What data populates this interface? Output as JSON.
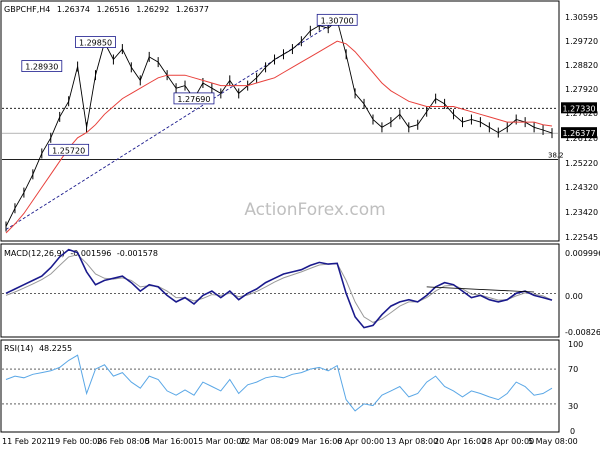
{
  "header": {
    "symbol": "GBPCHF,H4",
    "open": "1.26374",
    "high": "1.26516",
    "low": "1.26292",
    "close": "1.26377"
  },
  "watermark": "ActionForex.com",
  "colors": {
    "candles": "#000000",
    "ma": "#e8413c",
    "trend": "#1a1a8c",
    "macd": "#1a1a8c",
    "signal": "#9a9a9a",
    "rsi": "#5aa7e6",
    "label_border": "#1a1a8c",
    "grid": "#ffffff"
  },
  "x_axis": {
    "ticks": [
      "11 Feb 2021",
      "19 Feb 00:00",
      "26 Feb 08:00",
      "5 Mar 16:00",
      "15 Mar 00:00",
      "22 Mar 08:00",
      "29 Mar 16:00",
      "6 Apr 00:00",
      "13 Apr 08:00",
      "20 Apr 16:00",
      "28 Apr 00:00",
      "5 May 08:00"
    ]
  },
  "price_panel": {
    "y_ticks": [
      "1.30595",
      "1.29720",
      "1.28820",
      "1.27920",
      "1.27020",
      "1.26120",
      "1.25220",
      "1.24320",
      "1.23420",
      "1.22545"
    ],
    "ylim": [
      1.2236,
      1.3102
    ],
    "current_price_label": "1.26377",
    "current_price": 1.26377,
    "level_label": "1.27330",
    "level": 1.2733,
    "support_level": 1.2537,
    "fib_label": "38.2",
    "annotations": [
      {
        "text": "1.28930",
        "x_date": "17 Feb",
        "value": 1.2893
      },
      {
        "text": "1.29850",
        "x_date": "25 Feb",
        "value": 1.2985
      },
      {
        "text": "1.25720",
        "x_date": "22 Feb",
        "value": 1.2572
      },
      {
        "text": "1.27690",
        "x_date": "12 Mar",
        "value": 1.2769
      },
      {
        "text": "1.30700",
        "x_date": "5 Apr",
        "value": 1.307
      }
    ]
  },
  "macd_panel": {
    "title": "MACD(12,26,9)",
    "value1": "-0.001596",
    "value2": "-0.001578",
    "y_ticks": [
      "0.009996",
      "0.00",
      "-0.008264"
    ],
    "ylim": [
      -0.0095,
      0.0108
    ]
  },
  "rsi_panel": {
    "title": "RSI(14)",
    "value": "48.2255",
    "y_ticks": [
      "100",
      "70",
      "30",
      "0"
    ],
    "ylim": [
      0,
      100
    ]
  },
  "chart_data": [
    {
      "type": "line",
      "title": "GBPCHF,H4",
      "xlabel": "",
      "ylabel": "",
      "ylim": [
        1.2236,
        1.3102
      ],
      "x": [
        "11 Feb",
        "12 Feb",
        "15 Feb",
        "16 Feb",
        "17 Feb",
        "18 Feb",
        "19 Feb",
        "22 Feb",
        "23 Feb",
        "24 Feb",
        "25 Feb",
        "26 Feb",
        "1 Mar",
        "2 Mar",
        "3 Mar",
        "4 Mar",
        "5 Mar",
        "8 Mar",
        "9 Mar",
        "10 Mar",
        "11 Mar",
        "12 Mar",
        "15 Mar",
        "16 Mar",
        "17 Mar",
        "18 Mar",
        "19 Mar",
        "22 Mar",
        "23 Mar",
        "24 Mar",
        "25 Mar",
        "26 Mar",
        "29 Mar",
        "30 Mar",
        "31 Mar",
        "1 Apr",
        "2 Apr",
        "5 Apr",
        "6 Apr",
        "7 Apr",
        "8 Apr",
        "9 Apr",
        "12 Apr",
        "13 Apr",
        "14 Apr",
        "15 Apr",
        "16 Apr",
        "19 Apr",
        "20 Apr",
        "21 Apr",
        "22 Apr",
        "23 Apr",
        "26 Apr",
        "27 Apr",
        "28 Apr",
        "29 Apr",
        "30 Apr",
        "3 May",
        "4 May",
        "5 May",
        "6 May",
        "7 May"
      ],
      "series": [
        {
          "values": [
            1.228,
            1.235,
            1.241,
            1.248,
            1.256,
            1.262,
            1.27,
            1.276,
            1.2893,
            1.266,
            1.286,
            1.2985,
            1.292,
            1.296,
            1.289,
            1.284,
            1.293,
            1.291,
            1.286,
            1.281,
            1.282,
            1.277,
            1.283,
            1.281,
            1.279,
            1.284,
            1.279,
            1.282,
            1.285,
            1.289,
            1.292,
            1.294,
            1.296,
            1.299,
            1.303,
            1.305,
            1.304,
            1.307,
            1.294,
            1.279,
            1.275,
            1.269,
            1.266,
            1.268,
            1.271,
            1.266,
            1.267,
            1.272,
            1.277,
            1.275,
            1.271,
            1.268,
            1.269,
            1.268,
            1.266,
            1.264,
            1.266,
            1.269,
            1.268,
            1.266,
            1.265,
            1.2638
          ]
        },
        {
          "values": [
            1.2255,
            1.229,
            1.233,
            1.238,
            1.243,
            1.248,
            1.253,
            1.258,
            1.262,
            1.264,
            1.267,
            1.271,
            1.274,
            1.277,
            1.279,
            1.281,
            1.283,
            1.285,
            1.286,
            1.286,
            1.286,
            1.285,
            1.284,
            1.283,
            1.282,
            1.282,
            1.282,
            1.282,
            1.283,
            1.284,
            1.285,
            1.287,
            1.289,
            1.291,
            1.293,
            1.295,
            1.297,
            1.299,
            1.298,
            1.295,
            1.291,
            1.287,
            1.283,
            1.28,
            1.278,
            1.276,
            1.275,
            1.274,
            1.274,
            1.274,
            1.274,
            1.273,
            1.272,
            1.271,
            1.27,
            1.269,
            1.268,
            1.268,
            1.268,
            1.268,
            1.267,
            1.2665
          ]
        }
      ]
    },
    {
      "type": "line",
      "title": "MACD(12,26,9)",
      "ylim": [
        -0.0095,
        0.0108
      ],
      "x": [
        "11 Feb",
        "12 Feb",
        "15 Feb",
        "16 Feb",
        "17 Feb",
        "18 Feb",
        "19 Feb",
        "22 Feb",
        "23 Feb",
        "24 Feb",
        "25 Feb",
        "26 Feb",
        "1 Mar",
        "2 Mar",
        "3 Mar",
        "4 Mar",
        "5 Mar",
        "8 Mar",
        "9 Mar",
        "10 Mar",
        "11 Mar",
        "12 Mar",
        "15 Mar",
        "16 Mar",
        "17 Mar",
        "18 Mar",
        "19 Mar",
        "22 Mar",
        "23 Mar",
        "24 Mar",
        "25 Mar",
        "26 Mar",
        "29 Mar",
        "30 Mar",
        "31 Mar",
        "1 Apr",
        "2 Apr",
        "5 Apr",
        "6 Apr",
        "7 Apr",
        "8 Apr",
        "9 Apr",
        "12 Apr",
        "13 Apr",
        "14 Apr",
        "15 Apr",
        "16 Apr",
        "19 Apr",
        "20 Apr",
        "21 Apr",
        "22 Apr",
        "23 Apr",
        "26 Apr",
        "27 Apr",
        "28 Apr",
        "29 Apr",
        "30 Apr",
        "3 May",
        "4 May",
        "5 May",
        "6 May",
        "7 May"
      ],
      "series": [
        {
          "values": [
            0.0,
            0.001,
            0.002,
            0.003,
            0.004,
            0.006,
            0.0085,
            0.0102,
            0.0095,
            0.005,
            0.002,
            0.003,
            0.0035,
            0.004,
            0.0025,
            0.0005,
            0.002,
            0.0015,
            -0.0005,
            -0.002,
            -0.001,
            -0.0025,
            -0.0005,
            0.0005,
            -0.001,
            0.0005,
            -0.0015,
            0.0,
            0.001,
            0.0025,
            0.0035,
            0.0045,
            0.005,
            0.0055,
            0.0065,
            0.0072,
            0.0068,
            0.007,
            0.0,
            -0.0055,
            -0.008,
            -0.0075,
            -0.005,
            -0.003,
            -0.002,
            -0.0015,
            -0.002,
            -0.0005,
            0.0015,
            0.0025,
            0.002,
            0.0005,
            -0.001,
            -0.0005,
            -0.0015,
            -0.002,
            -0.0015,
            0.0,
            0.0005,
            -0.0005,
            -0.001,
            -0.0016
          ]
        },
        {
          "values": [
            -0.0005,
            0.0003,
            0.0012,
            0.0022,
            0.0032,
            0.0045,
            0.0065,
            0.0085,
            0.009,
            0.007,
            0.0045,
            0.0035,
            0.0033,
            0.0036,
            0.003,
            0.0015,
            0.0018,
            0.0016,
            0.0005,
            -0.001,
            -0.001,
            -0.0018,
            -0.0012,
            -0.0003,
            -0.0005,
            0.0,
            -0.0008,
            -0.0004,
            0.0004,
            0.0015,
            0.0026,
            0.0036,
            0.0043,
            0.005,
            0.0058,
            0.0066,
            0.0068,
            0.0069,
            0.003,
            -0.002,
            -0.0055,
            -0.0068,
            -0.006,
            -0.0045,
            -0.003,
            -0.002,
            -0.002,
            -0.001,
            0.0005,
            0.0017,
            0.0019,
            0.001,
            -0.0002,
            -0.0004,
            -0.001,
            -0.0016,
            -0.0015,
            -0.0006,
            0.0001,
            -0.0002,
            -0.0006,
            -0.0016
          ]
        }
      ]
    },
    {
      "type": "line",
      "title": "RSI(14)",
      "ylim": [
        0,
        100
      ],
      "x": [
        "11 Feb",
        "12 Feb",
        "15 Feb",
        "16 Feb",
        "17 Feb",
        "18 Feb",
        "19 Feb",
        "22 Feb",
        "23 Feb",
        "24 Feb",
        "25 Feb",
        "26 Feb",
        "1 Mar",
        "2 Mar",
        "3 Mar",
        "4 Mar",
        "5 Mar",
        "8 Mar",
        "9 Mar",
        "10 Mar",
        "11 Mar",
        "12 Mar",
        "15 Mar",
        "16 Mar",
        "17 Mar",
        "18 Mar",
        "19 Mar",
        "22 Mar",
        "23 Mar",
        "24 Mar",
        "25 Mar",
        "26 Mar",
        "29 Mar",
        "30 Mar",
        "31 Mar",
        "1 Apr",
        "2 Apr",
        "5 Apr",
        "6 Apr",
        "7 Apr",
        "8 Apr",
        "9 Apr",
        "12 Apr",
        "13 Apr",
        "14 Apr",
        "15 Apr",
        "16 Apr",
        "19 Apr",
        "20 Apr",
        "21 Apr",
        "22 Apr",
        "23 Apr",
        "26 Apr",
        "27 Apr",
        "28 Apr",
        "29 Apr",
        "30 Apr",
        "3 May",
        "4 May",
        "5 May",
        "6 May",
        "7 May"
      ],
      "series": [
        {
          "values": [
            58,
            62,
            60,
            64,
            66,
            68,
            72,
            80,
            86,
            42,
            70,
            75,
            62,
            66,
            55,
            48,
            62,
            58,
            45,
            40,
            46,
            40,
            55,
            50,
            45,
            58,
            42,
            52,
            55,
            60,
            62,
            60,
            64,
            66,
            70,
            72,
            68,
            74,
            35,
            22,
            30,
            28,
            40,
            45,
            50,
            38,
            42,
            55,
            62,
            50,
            45,
            38,
            45,
            42,
            38,
            35,
            42,
            55,
            50,
            40,
            42,
            48
          ]
        }
      ]
    }
  ]
}
